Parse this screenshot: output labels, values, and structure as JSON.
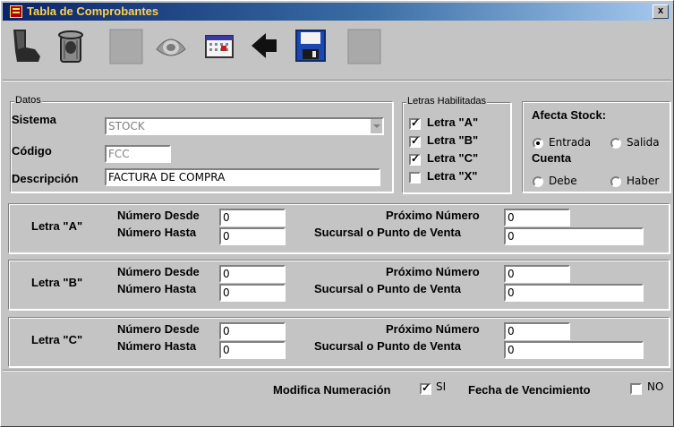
{
  "window": {
    "title": "Tabla de Comprobantes",
    "close_label": "x"
  },
  "toolbar": {
    "buttons": [
      "exit-icon",
      "trash-icon",
      "disabled-icon",
      "search-icon",
      "calendar-icon",
      "back-arrow-icon",
      "save-icon",
      "disabled-icon"
    ]
  },
  "datos": {
    "legend": "Datos",
    "sistema_label": "Sistema",
    "sistema_value": "STOCK",
    "codigo_label": "Código",
    "codigo_value": "FCC",
    "descripcion_label": "Descripción",
    "descripcion_value": "FACTURA DE COMPRA"
  },
  "letras": {
    "legend": "Letras Habilitadas",
    "items": [
      {
        "label": "Letra \"A\"",
        "checked": true
      },
      {
        "label": "Letra \"B\"",
        "checked": true
      },
      {
        "label": "Letra \"C\"",
        "checked": true
      },
      {
        "label": "Letra \"X\"",
        "checked": false
      }
    ]
  },
  "stock": {
    "title": "Afecta Stock:",
    "entrada": "Entrada",
    "salida": "Salida",
    "selected": "Entrada",
    "cuenta_label": "Cuenta",
    "debe": "Debe",
    "haber": "Haber"
  },
  "panels": [
    {
      "letra": "Letra \"A\"",
      "desde_label": "Número Desde",
      "desde": "0",
      "hasta_label": "Número Hasta",
      "hasta": "0",
      "proximo_label": "Próximo Número",
      "proximo": "0",
      "sucursal_label": "Sucursal o Punto de Venta",
      "sucursal": "0"
    },
    {
      "letra": "Letra \"B\"",
      "desde_label": "Número Desde",
      "desde": "0",
      "hasta_label": "Número Hasta",
      "hasta": "0",
      "proximo_label": "Próximo Número",
      "proximo": "0",
      "sucursal_label": "Sucursal o Punto de Venta",
      "sucursal": "0"
    },
    {
      "letra": "Letra \"C\"",
      "desde_label": "Número Desde",
      "desde": "0",
      "hasta_label": "Número Hasta",
      "hasta": "0",
      "proximo_label": "Próximo Número",
      "proximo": "0",
      "sucursal_label": "Sucursal o Punto de Venta",
      "sucursal": "0"
    }
  ],
  "footer": {
    "modifica_label": "Modifica Numeración",
    "modifica_value": "SI",
    "modifica_checked": true,
    "vencimiento_label": "Fecha de Vencimiento",
    "vencimiento_value": "NO",
    "vencimiento_checked": false
  }
}
